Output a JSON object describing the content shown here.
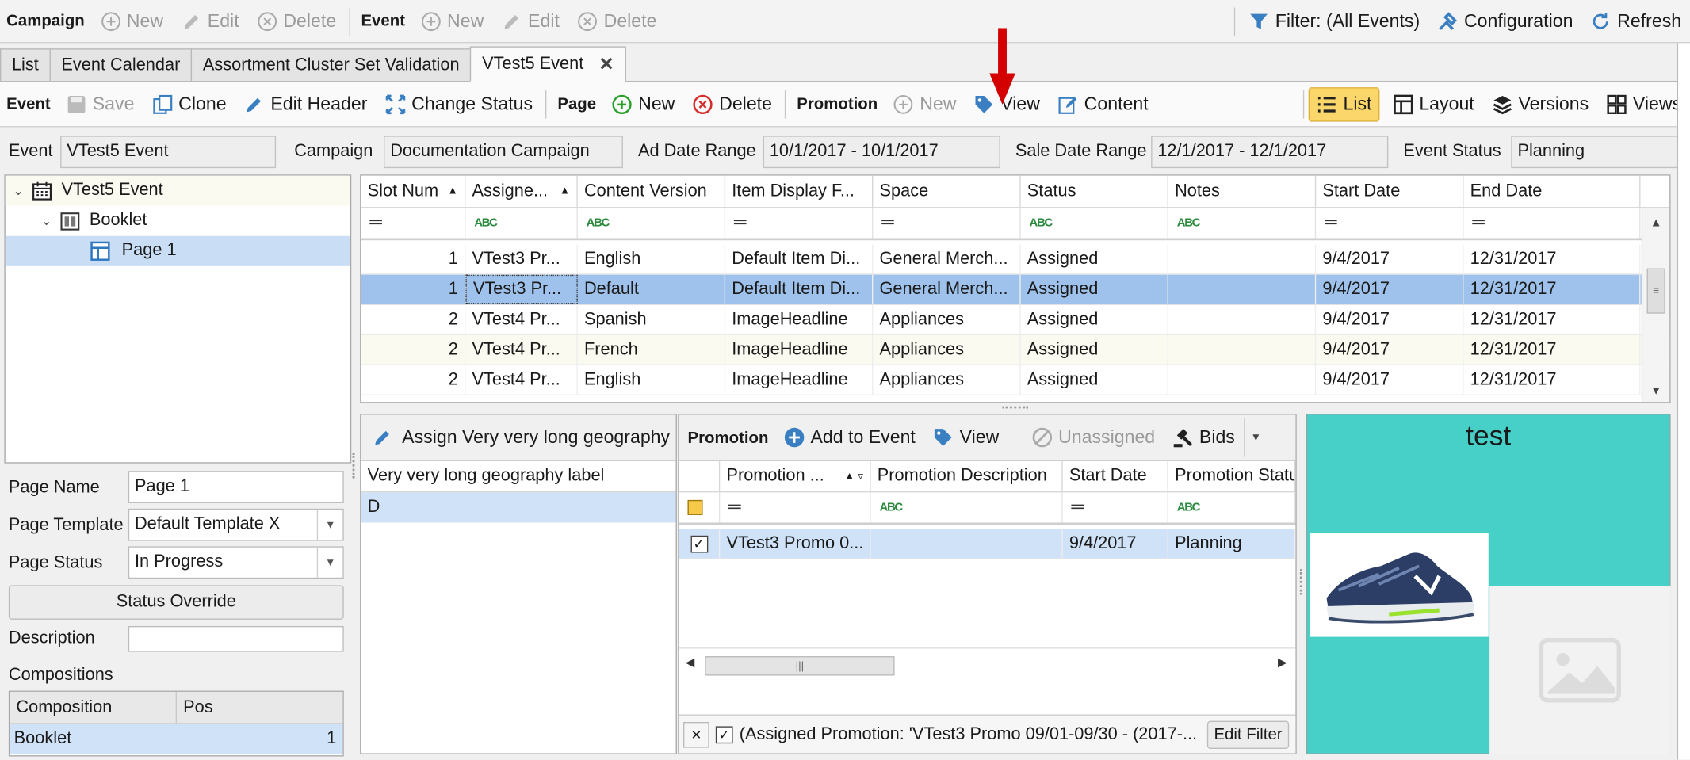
{
  "toolbar1": {
    "campaign_group": "Campaign",
    "campaign_new": "New",
    "campaign_edit": "Edit",
    "campaign_delete": "Delete",
    "event_group": "Event",
    "event_new": "New",
    "event_edit": "Edit",
    "event_delete": "Delete",
    "filter": "Filter: (All Events)",
    "configuration": "Configuration",
    "refresh": "Refresh"
  },
  "tabs": [
    "List",
    "Event Calendar",
    "Assortment Cluster Set Validation",
    "VTest5 Event"
  ],
  "toolbar2": {
    "event_group": "Event",
    "save": "Save",
    "clone": "Clone",
    "edit_header": "Edit Header",
    "change_status": "Change Status",
    "page_group": "Page",
    "page_new": "New",
    "page_delete": "Delete",
    "promotion_group": "Promotion",
    "promo_new": "New",
    "promo_view": "View",
    "promo_content": "Content",
    "list": "List",
    "layout": "Layout",
    "versions": "Versions",
    "views": "Views"
  },
  "header_fields": {
    "event_label": "Event",
    "event_value": "VTest5 Event",
    "campaign_label": "Campaign",
    "campaign_value": "Documentation Campaign",
    "ad_date_label": "Ad Date Range",
    "ad_date_value": "10/1/2017 - 10/1/2017",
    "sale_date_label": "Sale Date Range",
    "sale_date_value": "12/1/2017 - 12/1/2017",
    "status_label": "Event Status",
    "status_value": "Planning"
  },
  "tree": {
    "root": "VTest5 Event",
    "booklet": "Booklet",
    "page": "Page 1"
  },
  "slot_grid": {
    "columns": [
      "Slot Num",
      "Assigne...",
      "Content Version",
      "Item Display F...",
      "Space",
      "Status",
      "Notes",
      "Start Date",
      "End Date"
    ],
    "rows": [
      [
        "1",
        "VTest3 Pr...",
        "English",
        "Default Item Di...",
        "General Merch...",
        "Assigned",
        "",
        "9/4/2017",
        "12/31/2017"
      ],
      [
        "1",
        "VTest3 Pr...",
        "Default",
        "Default Item Di...",
        "General Merch...",
        "Assigned",
        "",
        "9/4/2017",
        "12/31/2017"
      ],
      [
        "2",
        "VTest4 Pr...",
        "Spanish",
        "ImageHeadline",
        "Appliances",
        "Assigned",
        "",
        "9/4/2017",
        "12/31/2017"
      ],
      [
        "2",
        "VTest4 Pr...",
        "French",
        "ImageHeadline",
        "Appliances",
        "Assigned",
        "",
        "9/4/2017",
        "12/31/2017"
      ],
      [
        "2",
        "VTest4 Pr...",
        "English",
        "ImageHeadline",
        "Appliances",
        "Assigned",
        "",
        "9/4/2017",
        "12/31/2017"
      ]
    ]
  },
  "page_props": {
    "page_name_label": "Page Name",
    "page_name_value": "Page 1",
    "template_label": "Page Template",
    "template_value": "Default Template X",
    "status_label": "Page Status",
    "status_value": "In Progress",
    "status_override": "Status Override",
    "description_label": "Description",
    "compositions_label": "Compositions",
    "comp_col1": "Composition",
    "comp_col2": "Pos",
    "comp_row_name": "Booklet",
    "comp_row_pos": "1"
  },
  "geo_panel": {
    "assign_button": "Assign Very very long geography",
    "column": "Very very long geography label",
    "row": "D"
  },
  "promo_panel": {
    "group": "Promotion",
    "add_to_event": "Add to Event",
    "view": "View",
    "unassigned": "Unassigned",
    "bids": "Bids",
    "columns": [
      "Promotion ...",
      "Promotion Description",
      "Start Date",
      "Promotion Statu"
    ],
    "row": [
      "VTest3 Promo 0...",
      "",
      "9/4/2017",
      "Planning"
    ],
    "filter_text": "(Assigned Promotion: 'VTest3 Promo 09/01-09/30 - (2017-...",
    "edit_filter": "Edit Filter"
  },
  "preview": {
    "title": "test",
    "bg_color": "#47d0c8"
  }
}
